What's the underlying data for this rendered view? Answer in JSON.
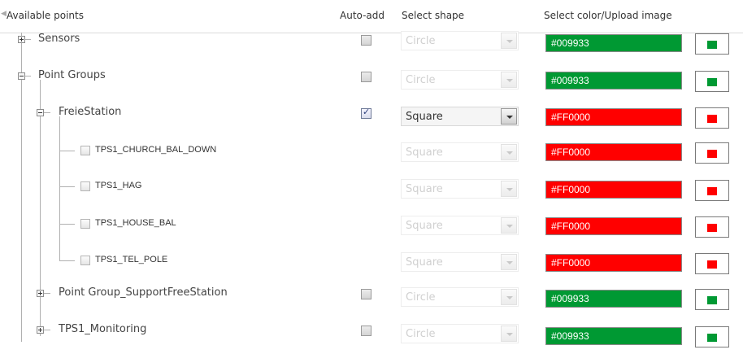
{
  "header": {
    "available_points": "Available points",
    "auto_add": "Auto-add",
    "select_shape": "Select shape",
    "select_color": "Select color/Upload image"
  },
  "colors": {
    "green": "#009933",
    "red": "#FF0000",
    "tree_line": "#b0b0b0"
  },
  "rows": [
    {
      "label": "Sensors",
      "type": "node",
      "expander": "plus",
      "auto_add": false,
      "shape": "Circle",
      "shape_enabled": false,
      "color_text": "#009933",
      "color": "#009933"
    },
    {
      "label": "Point Groups",
      "type": "node",
      "expander": "minus",
      "auto_add": false,
      "shape": "Circle",
      "shape_enabled": false,
      "color_text": "#009933",
      "color": "#009933"
    },
    {
      "label": "FreieStation",
      "type": "node",
      "expander": "minus",
      "auto_add": true,
      "shape": "Square",
      "shape_enabled": true,
      "color_text": "#FF0000",
      "color": "#FF0000"
    },
    {
      "label": "TPS1_CHURCH_BAL_DOWN",
      "type": "leaf",
      "checked": false,
      "shape": "Square",
      "shape_enabled": false,
      "color_text": "#FF0000",
      "color": "#FF0000"
    },
    {
      "label": "TPS1_HAG",
      "type": "leaf",
      "checked": false,
      "shape": "Square",
      "shape_enabled": false,
      "color_text": "#FF0000",
      "color": "#FF0000"
    },
    {
      "label": "TPS1_HOUSE_BAL",
      "type": "leaf",
      "checked": false,
      "shape": "Square",
      "shape_enabled": false,
      "color_text": "#FF0000",
      "color": "#FF0000"
    },
    {
      "label": "TPS1_TEL_POLE",
      "type": "leaf",
      "checked": false,
      "shape": "Square",
      "shape_enabled": false,
      "color_text": "#FF0000",
      "color": "#FF0000"
    },
    {
      "label": "Point Group_SupportFreeStation",
      "type": "node",
      "expander": "plus",
      "auto_add": false,
      "shape": "Circle",
      "shape_enabled": false,
      "color_text": "#009933",
      "color": "#009933"
    },
    {
      "label": "TPS1_Monitoring",
      "type": "node",
      "expander": "plus",
      "auto_add": false,
      "shape": "Circle",
      "shape_enabled": false,
      "color_text": "#009933",
      "color": "#009933"
    }
  ]
}
